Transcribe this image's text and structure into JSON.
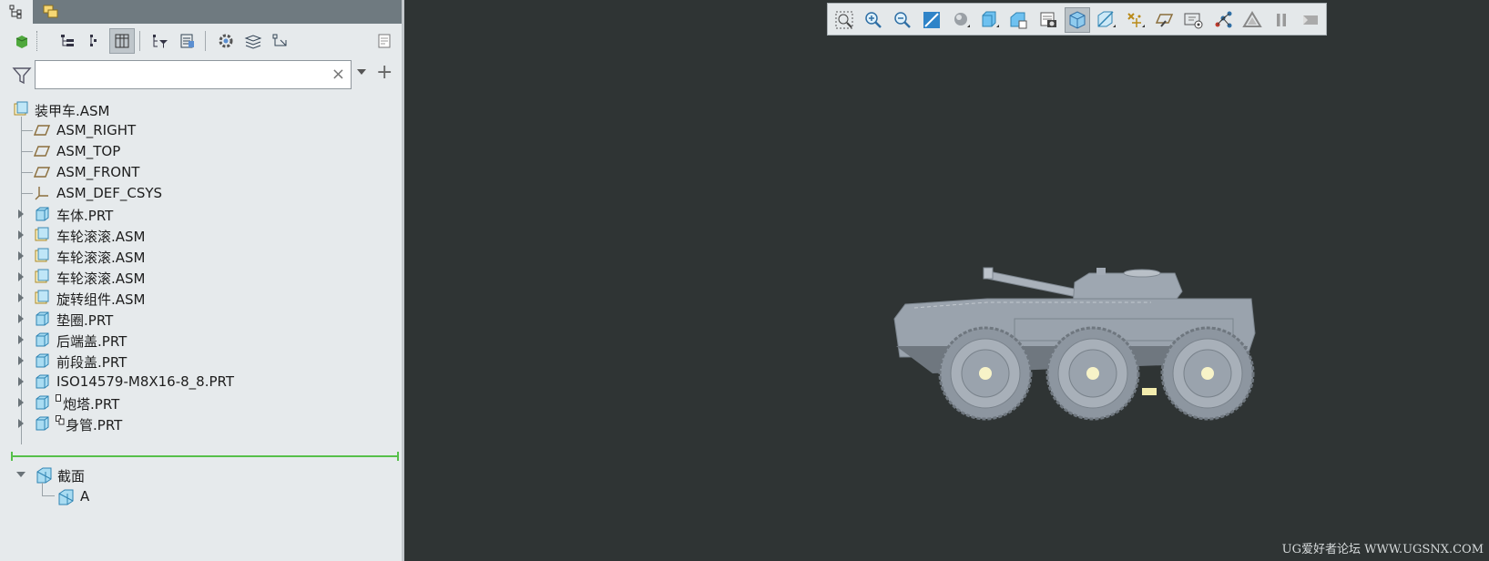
{
  "tabs": [
    {
      "name": "model-tree-tab",
      "icon": "model-tree-icon",
      "active": true
    },
    {
      "name": "layers-tab",
      "icon": "layers-icon",
      "active": false
    }
  ],
  "tree_tools": [
    "settings-icon",
    "tree-columns-icon",
    "expand-icon",
    "show-columns-icon",
    "filter-tree-icon",
    "tree-settings-icon",
    "options-icon",
    "layers-icon",
    "references-icon",
    "notes-icon"
  ],
  "search": {
    "value": "",
    "placeholder": ""
  },
  "tree": {
    "root": "装甲车.ASM",
    "items": [
      {
        "label": "ASM_RIGHT",
        "type": "datum-plane"
      },
      {
        "label": "ASM_TOP",
        "type": "datum-plane"
      },
      {
        "label": "ASM_FRONT",
        "type": "datum-plane"
      },
      {
        "label": "ASM_DEF_CSYS",
        "type": "csys"
      },
      {
        "label": "车体.PRT",
        "type": "part"
      },
      {
        "label": "车轮滚滚.ASM",
        "type": "asm"
      },
      {
        "label": "车轮滚滚.ASM",
        "type": "asm"
      },
      {
        "label": "车轮滚滚.ASM",
        "type": "asm"
      },
      {
        "label": "旋转组件.ASM",
        "type": "asm"
      },
      {
        "label": "垫圈.PRT",
        "type": "part"
      },
      {
        "label": "后端盖.PRT",
        "type": "part"
      },
      {
        "label": "前段盖.PRT",
        "type": "part"
      },
      {
        "label": "ISO14579-M8X16-8_8.PRT",
        "type": "part"
      },
      {
        "label": "炮塔.PRT",
        "type": "part"
      },
      {
        "label": "身管.PRT",
        "type": "part"
      }
    ],
    "sections_label": "截面",
    "section_items": [
      "A"
    ]
  },
  "view_toolbar": [
    "zoom-fit-icon",
    "zoom-in-icon",
    "zoom-out-icon",
    "repaint-icon",
    "display-style-icon",
    "saved-views-icon",
    "named-views-icon",
    "view-manager-icon",
    "perspective-icon",
    "section-icon",
    "datum-display-icon",
    "annotation-icon",
    "spin-center-icon",
    "appearance-icon",
    "performance-icon",
    "pause-icon",
    "exit-icon"
  ],
  "colors": {
    "viewport_bg": "#2f3434",
    "model": "#9aa3ad",
    "accent_green": "#56c04a"
  },
  "watermark": "UG爱好者论坛 WWW.UGSNX.COM"
}
